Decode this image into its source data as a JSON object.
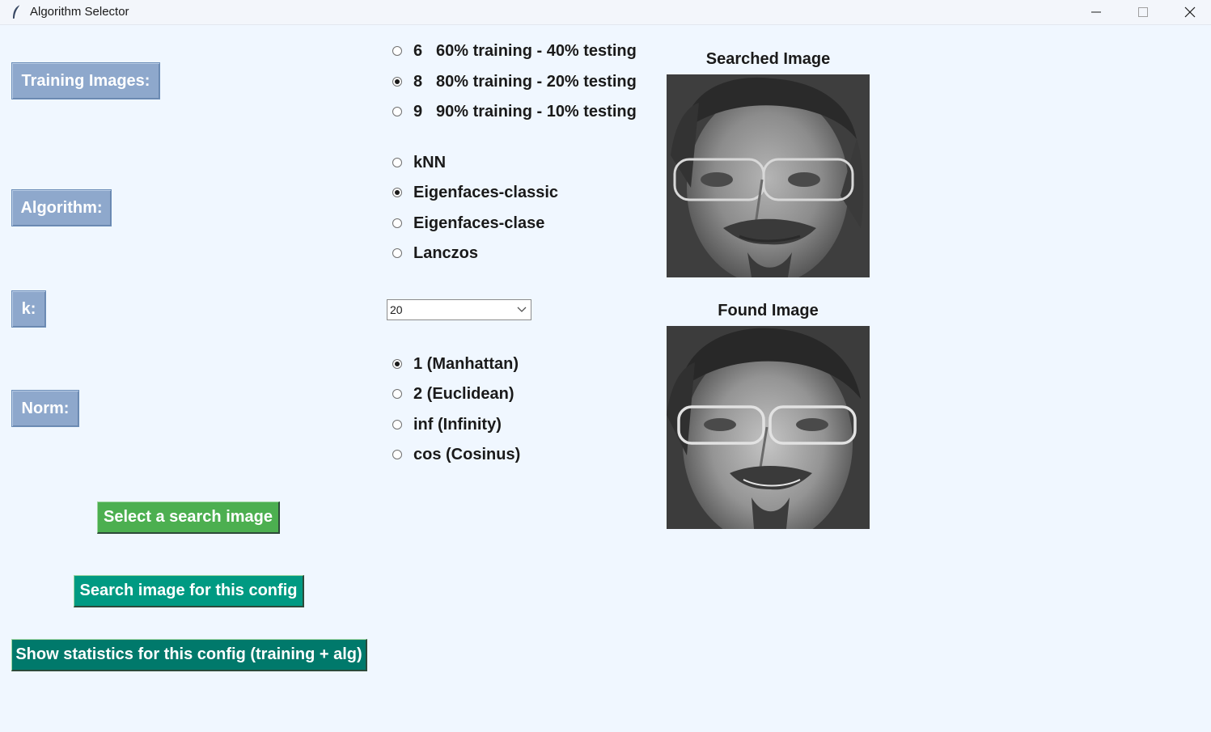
{
  "window": {
    "title": "Algorithm Selector"
  },
  "labels": {
    "training": "Training Images:",
    "algorithm": "Algorithm:",
    "k": "k:",
    "norm": "Norm:"
  },
  "training_options": [
    {
      "num": "6",
      "label": "60% training - 40% testing",
      "selected": false
    },
    {
      "num": "8",
      "label": "80% training - 20% testing",
      "selected": true
    },
    {
      "num": "9",
      "label": "90% training - 10% testing",
      "selected": false
    }
  ],
  "algorithm_options": [
    {
      "label": "kNN",
      "selected": false
    },
    {
      "label": "Eigenfaces-classic",
      "selected": true
    },
    {
      "label": "Eigenfaces-clase",
      "selected": false
    },
    {
      "label": "Lanczos",
      "selected": false
    }
  ],
  "k_select": {
    "value": "20"
  },
  "norm_options": [
    {
      "label": "1 (Manhattan)",
      "selected": true
    },
    {
      "label": "2 (Euclidean)",
      "selected": false
    },
    {
      "label": "inf (Infinity)",
      "selected": false
    },
    {
      "label": "cos (Cosinus)",
      "selected": false
    }
  ],
  "images": {
    "searched_caption": "Searched Image",
    "found_caption": "Found Image"
  },
  "buttons": {
    "select_search": "Select a search image",
    "search_config": "Search image for this config",
    "show_stats": "Show statistics for this config (training + alg)"
  },
  "colors": {
    "background": "#f0f7ff",
    "label_bg": "#8ea8cc",
    "green_button": "#4caf50",
    "teal_button": "#009a82",
    "dark_teal_button": "#00796b"
  }
}
